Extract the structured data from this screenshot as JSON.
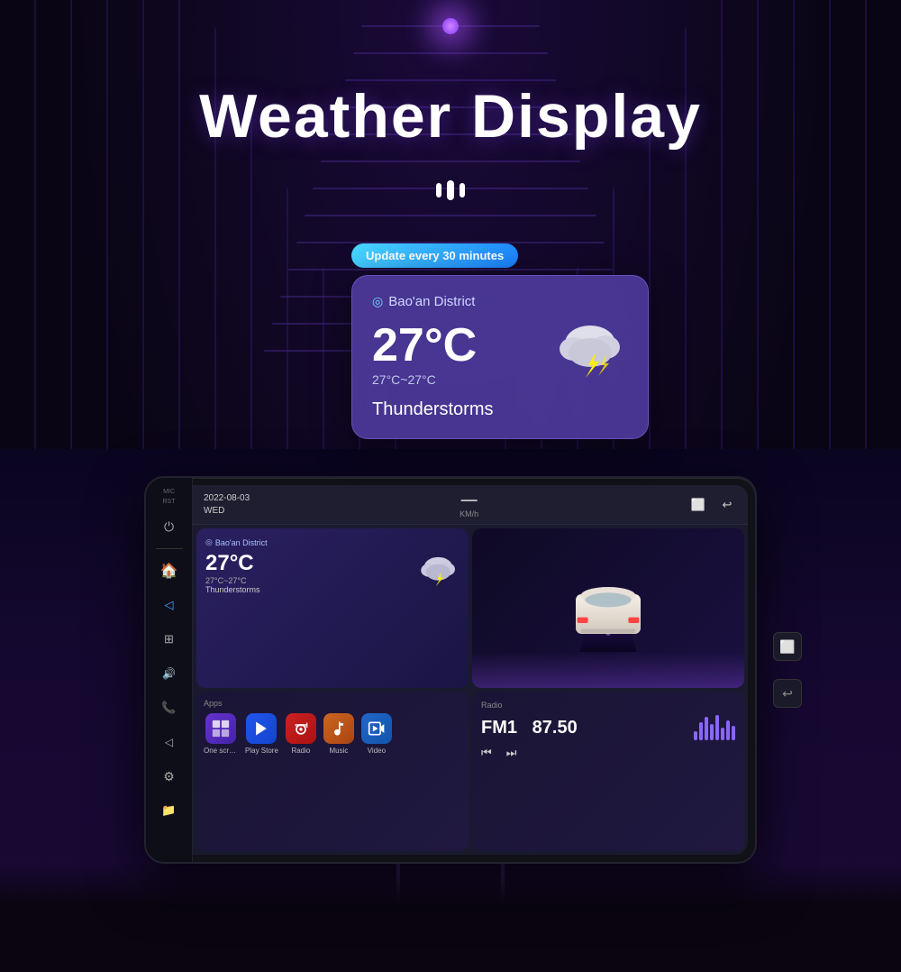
{
  "page": {
    "title": "Weather Display",
    "background_color": "#0a0515"
  },
  "header": {
    "title": "Weather Display"
  },
  "weather_popup": {
    "badge": "Update every 30 minutes",
    "location": "Bao'an District",
    "temperature": "27°C",
    "temp_range": "27°C~27°C",
    "description": "Thunderstorms",
    "icon": "⛈️"
  },
  "unit": {
    "datetime": "2022-08-03\nWED",
    "speed_label": "KM/h",
    "mic_label": "MIC",
    "rst_label": "RST"
  },
  "weather_tile": {
    "location": "Bao'an District",
    "temperature": "27°C",
    "temp_range": "27°C~27°C",
    "description": "Thunderstorms"
  },
  "radio_tile": {
    "header": "Radio",
    "channel": "FM1",
    "frequency": "87.50"
  },
  "apps_tile": {
    "header": "Apps",
    "apps": [
      {
        "name": "One screen in...",
        "icon": "🗂"
      },
      {
        "name": "Play Store",
        "icon": "▶"
      },
      {
        "name": "Radio",
        "icon": "📻"
      },
      {
        "name": "Music",
        "icon": "🎵"
      },
      {
        "name": "Video",
        "icon": "🎬"
      }
    ]
  },
  "sidebar": {
    "icons": [
      "🏠",
      "◁",
      "⊞",
      "🔊",
      "📞",
      "◁",
      "⚙",
      "📁"
    ]
  }
}
